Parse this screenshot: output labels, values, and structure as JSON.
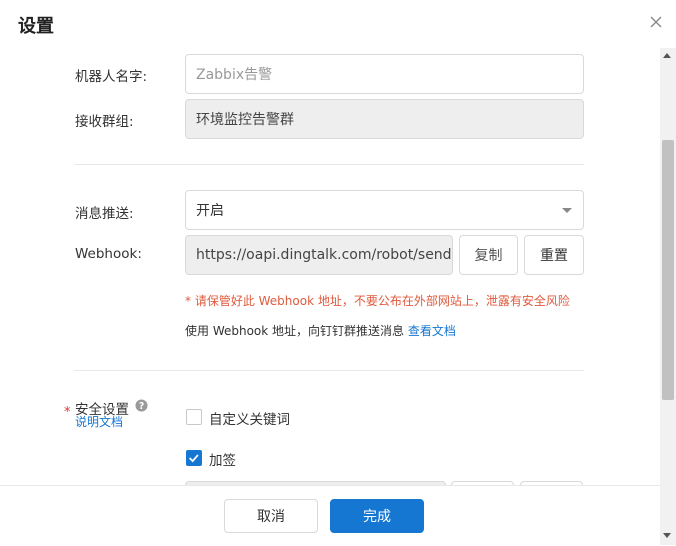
{
  "dialog": {
    "title": "设置"
  },
  "form": {
    "robot_name": {
      "label": "机器人名字:",
      "placeholder": "Zabbix告警"
    },
    "group": {
      "label": "接收群组:",
      "value": "环境监控告警群"
    },
    "push": {
      "label": "消息推送:",
      "value": "开启"
    },
    "webhook": {
      "label": "Webhook:",
      "value": "https://oapi.dingtalk.com/robot/send?ac",
      "copy_label": "复制",
      "reset_label": "重置",
      "warning": "* 请保管好此 Webhook 地址，不要公布在外部网站上，泄露有安全风险",
      "hint": "使用 Webhook 地址，向钉钉群推送消息",
      "doc_link": "查看文档"
    },
    "security": {
      "required_mark": "*",
      "label": "安全设置",
      "doc_link": "说明文档",
      "options": [
        {
          "label": "自定义关键词",
          "checked": false
        },
        {
          "label": "加签",
          "checked": true
        }
      ]
    }
  },
  "footer": {
    "cancel_label": "取消",
    "done_label": "完成"
  },
  "colors": {
    "primary": "#1677d2",
    "warning": "#e05a3c"
  }
}
